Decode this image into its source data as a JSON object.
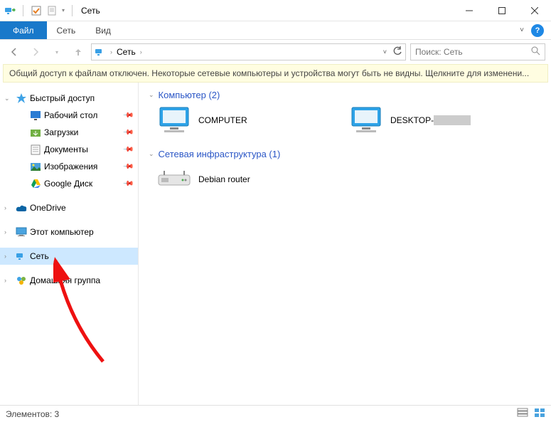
{
  "title": "Сеть",
  "ribbon": {
    "file": "Файл",
    "tabs": [
      "Сеть",
      "Вид"
    ]
  },
  "addressbar": {
    "location": "Сеть"
  },
  "search": {
    "placeholder": "Поиск: Сеть"
  },
  "warning": "Общий доступ к файлам отключен. Некоторые сетевые компьютеры и устройства могут быть не видны. Щелкните для изменени...",
  "sidebar": {
    "quick_access": "Быстрый доступ",
    "quick_items": [
      {
        "label": "Рабочий стол",
        "pin": true
      },
      {
        "label": "Загрузки",
        "pin": true
      },
      {
        "label": "Документы",
        "pin": true
      },
      {
        "label": "Изображения",
        "pin": true
      },
      {
        "label": "Google Диск",
        "pin": true
      }
    ],
    "onedrive": "OneDrive",
    "this_pc": "Этот компьютер",
    "network": "Сеть",
    "homegroup": "Домашняя группа"
  },
  "content": {
    "groups": [
      {
        "title": "Компьютер (2)",
        "items": [
          {
            "name": "COMPUTER"
          },
          {
            "name": "DESKTOP-"
          }
        ]
      },
      {
        "title": "Сетевая инфраструктура (1)",
        "items": [
          {
            "name": "Debian router"
          }
        ]
      }
    ]
  },
  "status": {
    "elements": "Элементов: 3"
  }
}
